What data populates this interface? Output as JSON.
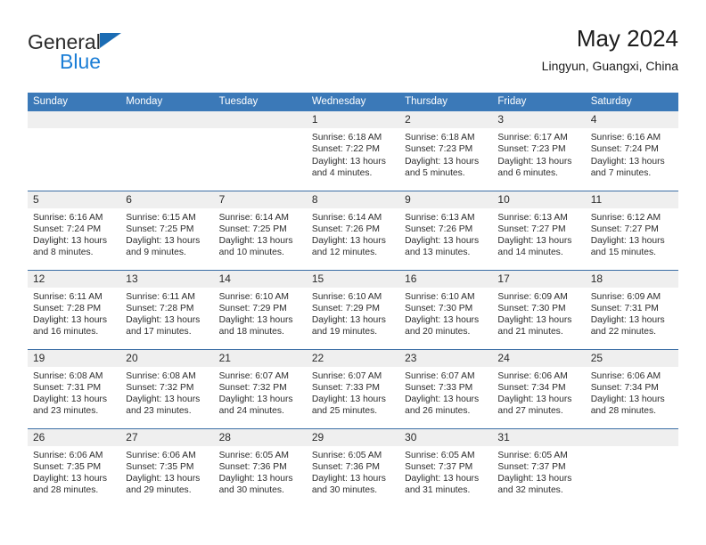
{
  "brand": {
    "name_part1": "General",
    "name_part2": "Blue",
    "triangle_icon": "triangle-icon",
    "color_dark": "#2b2b2b",
    "color_blue": "#1b7ed6"
  },
  "header": {
    "title": "May 2024",
    "subtitle": "Lingyun, Guangxi, China"
  },
  "theme": {
    "header_bg": "#3b79b8",
    "header_text": "#ffffff",
    "daynum_bg": "#efefef",
    "row_divider": "#3b6ea5",
    "body_text": "#2c2c2c"
  },
  "weekday_headers": [
    "Sunday",
    "Monday",
    "Tuesday",
    "Wednesday",
    "Thursday",
    "Friday",
    "Saturday"
  ],
  "weeks": [
    [
      {
        "day": "",
        "empty": true,
        "sunrise": "",
        "sunset": "",
        "daylight_line1": "",
        "daylight_line2": ""
      },
      {
        "day": "",
        "empty": true,
        "sunrise": "",
        "sunset": "",
        "daylight_line1": "",
        "daylight_line2": ""
      },
      {
        "day": "",
        "empty": true,
        "sunrise": "",
        "sunset": "",
        "daylight_line1": "",
        "daylight_line2": ""
      },
      {
        "day": "1",
        "empty": false,
        "sunrise": "Sunrise: 6:18 AM",
        "sunset": "Sunset: 7:22 PM",
        "daylight_line1": "Daylight: 13 hours",
        "daylight_line2": "and 4 minutes."
      },
      {
        "day": "2",
        "empty": false,
        "sunrise": "Sunrise: 6:18 AM",
        "sunset": "Sunset: 7:23 PM",
        "daylight_line1": "Daylight: 13 hours",
        "daylight_line2": "and 5 minutes."
      },
      {
        "day": "3",
        "empty": false,
        "sunrise": "Sunrise: 6:17 AM",
        "sunset": "Sunset: 7:23 PM",
        "daylight_line1": "Daylight: 13 hours",
        "daylight_line2": "and 6 minutes."
      },
      {
        "day": "4",
        "empty": false,
        "sunrise": "Sunrise: 6:16 AM",
        "sunset": "Sunset: 7:24 PM",
        "daylight_line1": "Daylight: 13 hours",
        "daylight_line2": "and 7 minutes."
      }
    ],
    [
      {
        "day": "5",
        "empty": false,
        "sunrise": "Sunrise: 6:16 AM",
        "sunset": "Sunset: 7:24 PM",
        "daylight_line1": "Daylight: 13 hours",
        "daylight_line2": "and 8 minutes."
      },
      {
        "day": "6",
        "empty": false,
        "sunrise": "Sunrise: 6:15 AM",
        "sunset": "Sunset: 7:25 PM",
        "daylight_line1": "Daylight: 13 hours",
        "daylight_line2": "and 9 minutes."
      },
      {
        "day": "7",
        "empty": false,
        "sunrise": "Sunrise: 6:14 AM",
        "sunset": "Sunset: 7:25 PM",
        "daylight_line1": "Daylight: 13 hours",
        "daylight_line2": "and 10 minutes."
      },
      {
        "day": "8",
        "empty": false,
        "sunrise": "Sunrise: 6:14 AM",
        "sunset": "Sunset: 7:26 PM",
        "daylight_line1": "Daylight: 13 hours",
        "daylight_line2": "and 12 minutes."
      },
      {
        "day": "9",
        "empty": false,
        "sunrise": "Sunrise: 6:13 AM",
        "sunset": "Sunset: 7:26 PM",
        "daylight_line1": "Daylight: 13 hours",
        "daylight_line2": "and 13 minutes."
      },
      {
        "day": "10",
        "empty": false,
        "sunrise": "Sunrise: 6:13 AM",
        "sunset": "Sunset: 7:27 PM",
        "daylight_line1": "Daylight: 13 hours",
        "daylight_line2": "and 14 minutes."
      },
      {
        "day": "11",
        "empty": false,
        "sunrise": "Sunrise: 6:12 AM",
        "sunset": "Sunset: 7:27 PM",
        "daylight_line1": "Daylight: 13 hours",
        "daylight_line2": "and 15 minutes."
      }
    ],
    [
      {
        "day": "12",
        "empty": false,
        "sunrise": "Sunrise: 6:11 AM",
        "sunset": "Sunset: 7:28 PM",
        "daylight_line1": "Daylight: 13 hours",
        "daylight_line2": "and 16 minutes."
      },
      {
        "day": "13",
        "empty": false,
        "sunrise": "Sunrise: 6:11 AM",
        "sunset": "Sunset: 7:28 PM",
        "daylight_line1": "Daylight: 13 hours",
        "daylight_line2": "and 17 minutes."
      },
      {
        "day": "14",
        "empty": false,
        "sunrise": "Sunrise: 6:10 AM",
        "sunset": "Sunset: 7:29 PM",
        "daylight_line1": "Daylight: 13 hours",
        "daylight_line2": "and 18 minutes."
      },
      {
        "day": "15",
        "empty": false,
        "sunrise": "Sunrise: 6:10 AM",
        "sunset": "Sunset: 7:29 PM",
        "daylight_line1": "Daylight: 13 hours",
        "daylight_line2": "and 19 minutes."
      },
      {
        "day": "16",
        "empty": false,
        "sunrise": "Sunrise: 6:10 AM",
        "sunset": "Sunset: 7:30 PM",
        "daylight_line1": "Daylight: 13 hours",
        "daylight_line2": "and 20 minutes."
      },
      {
        "day": "17",
        "empty": false,
        "sunrise": "Sunrise: 6:09 AM",
        "sunset": "Sunset: 7:30 PM",
        "daylight_line1": "Daylight: 13 hours",
        "daylight_line2": "and 21 minutes."
      },
      {
        "day": "18",
        "empty": false,
        "sunrise": "Sunrise: 6:09 AM",
        "sunset": "Sunset: 7:31 PM",
        "daylight_line1": "Daylight: 13 hours",
        "daylight_line2": "and 22 minutes."
      }
    ],
    [
      {
        "day": "19",
        "empty": false,
        "sunrise": "Sunrise: 6:08 AM",
        "sunset": "Sunset: 7:31 PM",
        "daylight_line1": "Daylight: 13 hours",
        "daylight_line2": "and 23 minutes."
      },
      {
        "day": "20",
        "empty": false,
        "sunrise": "Sunrise: 6:08 AM",
        "sunset": "Sunset: 7:32 PM",
        "daylight_line1": "Daylight: 13 hours",
        "daylight_line2": "and 23 minutes."
      },
      {
        "day": "21",
        "empty": false,
        "sunrise": "Sunrise: 6:07 AM",
        "sunset": "Sunset: 7:32 PM",
        "daylight_line1": "Daylight: 13 hours",
        "daylight_line2": "and 24 minutes."
      },
      {
        "day": "22",
        "empty": false,
        "sunrise": "Sunrise: 6:07 AM",
        "sunset": "Sunset: 7:33 PM",
        "daylight_line1": "Daylight: 13 hours",
        "daylight_line2": "and 25 minutes."
      },
      {
        "day": "23",
        "empty": false,
        "sunrise": "Sunrise: 6:07 AM",
        "sunset": "Sunset: 7:33 PM",
        "daylight_line1": "Daylight: 13 hours",
        "daylight_line2": "and 26 minutes."
      },
      {
        "day": "24",
        "empty": false,
        "sunrise": "Sunrise: 6:06 AM",
        "sunset": "Sunset: 7:34 PM",
        "daylight_line1": "Daylight: 13 hours",
        "daylight_line2": "and 27 minutes."
      },
      {
        "day": "25",
        "empty": false,
        "sunrise": "Sunrise: 6:06 AM",
        "sunset": "Sunset: 7:34 PM",
        "daylight_line1": "Daylight: 13 hours",
        "daylight_line2": "and 28 minutes."
      }
    ],
    [
      {
        "day": "26",
        "empty": false,
        "sunrise": "Sunrise: 6:06 AM",
        "sunset": "Sunset: 7:35 PM",
        "daylight_line1": "Daylight: 13 hours",
        "daylight_line2": "and 28 minutes."
      },
      {
        "day": "27",
        "empty": false,
        "sunrise": "Sunrise: 6:06 AM",
        "sunset": "Sunset: 7:35 PM",
        "daylight_line1": "Daylight: 13 hours",
        "daylight_line2": "and 29 minutes."
      },
      {
        "day": "28",
        "empty": false,
        "sunrise": "Sunrise: 6:05 AM",
        "sunset": "Sunset: 7:36 PM",
        "daylight_line1": "Daylight: 13 hours",
        "daylight_line2": "and 30 minutes."
      },
      {
        "day": "29",
        "empty": false,
        "sunrise": "Sunrise: 6:05 AM",
        "sunset": "Sunset: 7:36 PM",
        "daylight_line1": "Daylight: 13 hours",
        "daylight_line2": "and 30 minutes."
      },
      {
        "day": "30",
        "empty": false,
        "sunrise": "Sunrise: 6:05 AM",
        "sunset": "Sunset: 7:37 PM",
        "daylight_line1": "Daylight: 13 hours",
        "daylight_line2": "and 31 minutes."
      },
      {
        "day": "31",
        "empty": false,
        "sunrise": "Sunrise: 6:05 AM",
        "sunset": "Sunset: 7:37 PM",
        "daylight_line1": "Daylight: 13 hours",
        "daylight_line2": "and 32 minutes."
      },
      {
        "day": "",
        "empty": true,
        "sunrise": "",
        "sunset": "",
        "daylight_line1": "",
        "daylight_line2": ""
      }
    ]
  ]
}
